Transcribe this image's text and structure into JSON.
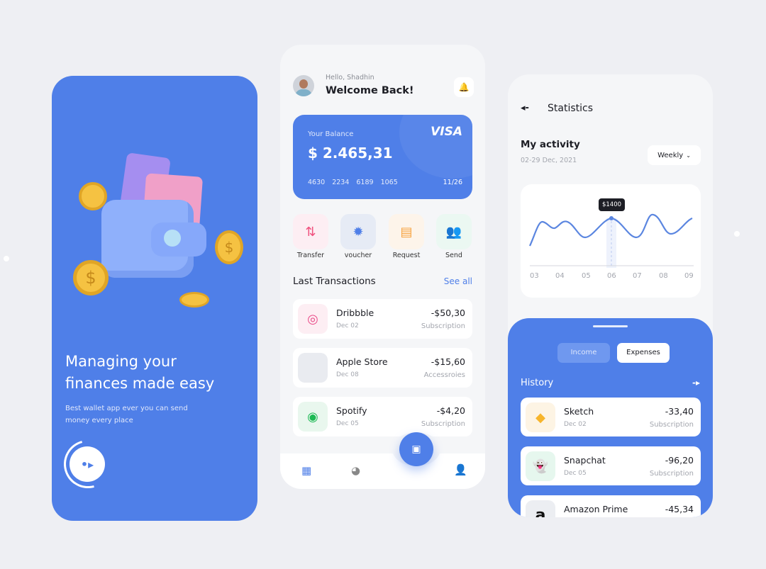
{
  "onboarding": {
    "title_line1": "Managing your",
    "title_line2": "finances made easy",
    "subtitle_line1": "Best wallet app ever you can send",
    "subtitle_line2": "money every place",
    "next_icon": "arrow-right-icon"
  },
  "home": {
    "greeting": "Hello, Shadhin",
    "welcome": "Welcome Back!",
    "card": {
      "label": "Your Balance",
      "balance": "$ 2.465,31",
      "brand": "VISA",
      "number": [
        "4630",
        "2234",
        "6189",
        "1065"
      ],
      "expiry": "11/26"
    },
    "actions": [
      {
        "label": "Transfer",
        "icon": "transfer-icon",
        "color": "#f0517e"
      },
      {
        "label": "voucher",
        "icon": "voucher-icon",
        "color": "#4f7fe8"
      },
      {
        "label": "Request",
        "icon": "document-icon",
        "color": "#f7a23e"
      },
      {
        "label": "Send",
        "icon": "people-icon",
        "color": "#3fcf9a"
      }
    ],
    "transactions_title": "Last Transactions",
    "see_all": "See all",
    "transactions": [
      {
        "name": "Dribbble",
        "date": "Dec 02",
        "amount": "-$50,30",
        "category": "Subscription"
      },
      {
        "name": "Apple Store",
        "date": "Dec 08",
        "amount": "-$15,60",
        "category": "Accessroies"
      },
      {
        "name": "Spotify",
        "date": "Dec 05",
        "amount": "-$4,20",
        "category": "Subscription"
      }
    ]
  },
  "stats": {
    "title": "Statistics",
    "activity": "My activity",
    "date_range": "02-29 Dec, 2021",
    "period": "Weekly",
    "tooltip": "$1400",
    "x_labels": [
      "03",
      "04",
      "05",
      "06",
      "07",
      "08",
      "09"
    ],
    "line_color": "#5b86e0",
    "tabs": [
      "Income",
      "Expenses"
    ],
    "history": "History",
    "items": [
      {
        "name": "Sketch",
        "date": "Dec 02",
        "amount": "-33,40",
        "category": "Subscription"
      },
      {
        "name": "Snapchat",
        "date": "Dec 05",
        "amount": "-96,20",
        "category": "Subscription"
      },
      {
        "name": "Amazon Prime",
        "amount": "-45,34"
      }
    ]
  },
  "colors": {
    "accent": "#4f7fe8",
    "background": "#eeeff3"
  }
}
